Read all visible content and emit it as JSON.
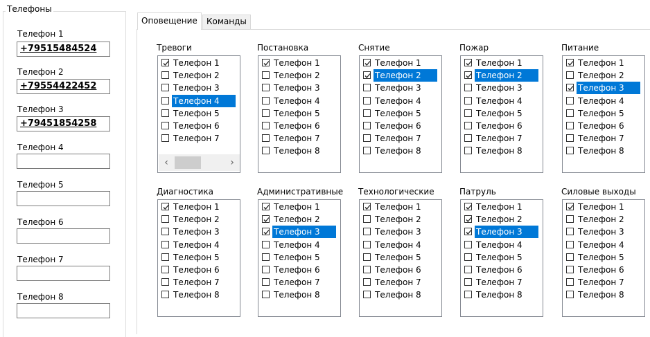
{
  "phones_group": {
    "title": "Телефоны",
    "phones": [
      {
        "label": "Телефон 1",
        "value": "+79515484524"
      },
      {
        "label": "Телефон 2",
        "value": "+79554422452"
      },
      {
        "label": "Телефон 3",
        "value": "+79451854258"
      },
      {
        "label": "Телефон 4",
        "value": ""
      },
      {
        "label": "Телефон 5",
        "value": ""
      },
      {
        "label": "Телефон 6",
        "value": ""
      },
      {
        "label": "Телефон 7",
        "value": ""
      },
      {
        "label": "Телефон 8",
        "value": ""
      }
    ]
  },
  "tabs": [
    {
      "label": "Оповещение",
      "active": true
    },
    {
      "label": "Команды",
      "active": false
    }
  ],
  "item_labels": [
    "Телефон 1",
    "Телефон 2",
    "Телефон 3",
    "Телефон 4",
    "Телефон 5",
    "Телефон 6",
    "Телефон 7",
    "Телефон 8"
  ],
  "lists": [
    {
      "title": "Тревоги",
      "visible_items": 7,
      "checked": [
        0
      ],
      "selected": 3,
      "hscroll": true
    },
    {
      "title": "Постановка",
      "visible_items": 8,
      "checked": [
        0
      ],
      "selected": null,
      "hscroll": false
    },
    {
      "title": "Снятие",
      "visible_items": 8,
      "checked": [
        0,
        1
      ],
      "selected": 1,
      "hscroll": false
    },
    {
      "title": "Пожар",
      "visible_items": 8,
      "checked": [
        0,
        1
      ],
      "selected": 1,
      "hscroll": false
    },
    {
      "title": "Питание",
      "visible_items": 8,
      "checked": [
        0,
        2
      ],
      "selected": 2,
      "hscroll": false
    },
    {
      "title": "Диагностика",
      "visible_items": 8,
      "checked": [
        0
      ],
      "selected": null,
      "hscroll": false
    },
    {
      "title": "Административные",
      "visible_items": 8,
      "checked": [
        0,
        1,
        2
      ],
      "selected": 2,
      "hscroll": false
    },
    {
      "title": "Технологические",
      "visible_items": 8,
      "checked": [
        0
      ],
      "selected": null,
      "hscroll": false
    },
    {
      "title": "Патруль",
      "visible_items": 8,
      "checked": [
        0,
        1,
        2
      ],
      "selected": 2,
      "hscroll": false
    },
    {
      "title": "Силовые выходы",
      "visible_items": 8,
      "checked": [
        0
      ],
      "selected": null,
      "hscroll": false
    }
  ],
  "scroll_icons": {
    "left": "‹",
    "right": "›"
  },
  "colors": {
    "selection": "#0078d7",
    "border": "#828790"
  }
}
